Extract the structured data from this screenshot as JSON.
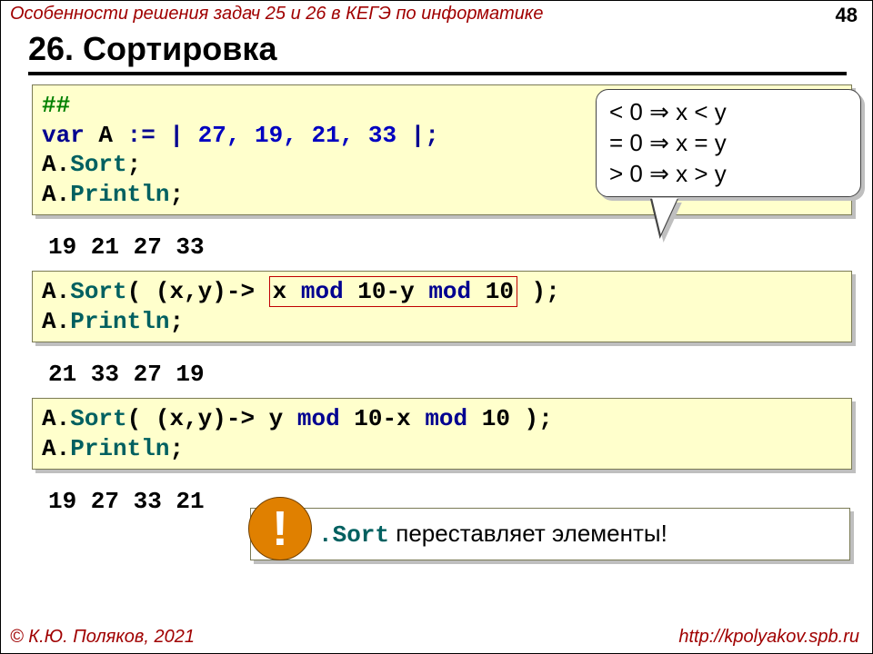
{
  "meta": {
    "subtitle": "Особенности решения задач 25 и 26 в КЕГЭ по информатике",
    "page": "48",
    "heading": "26. Сортировка"
  },
  "code": {
    "block1": {
      "l1": "##",
      "l2_var": "var",
      "l2_a": " A ",
      "l2_assign": ":= | ",
      "l2_nums": "27, 19, 21, 33",
      "l2_end": " |;",
      "l3_pre": "A.",
      "l3_sort": "Sort",
      "l3_end": ";",
      "l4_pre": "A.",
      "l4_pln": "Println",
      "l4_end": ";"
    },
    "out1": "19 21 27 33",
    "block2": {
      "l1_pre": "A.",
      "l1_sort": "Sort",
      "l1_open": "( (x,y)-> ",
      "l1_ins_a": "x ",
      "l1_ins_mod1": "mod",
      "l1_ins_b": " 10-y ",
      "l1_ins_mod2": "mod",
      "l1_ins_c": " 10",
      "l1_close": " );",
      "l2_pre": "A.",
      "l2_pln": "Println",
      "l2_end": ";"
    },
    "out2": "21 33 27 19",
    "block3": {
      "l1_pre": "A.",
      "l1_sort": "Sort",
      "l1_open": "( (x,y)-> y ",
      "l1_mod1": "mod",
      "l1_mid": " 10-x ",
      "l1_mod2": "mod",
      "l1_close2": " 10 );",
      "l2_pre": "A.",
      "l2_pln": "Println",
      "l2_end": ";"
    },
    "out3": "19 27 33 21"
  },
  "callout": {
    "r1_a": "< 0 ",
    "r1_arr": "⇒",
    "r1_b": " x < y",
    "r2_a": "= 0 ",
    "r2_arr": "⇒",
    "r2_b": " x = y",
    "r3_a": "> 0 ",
    "r3_arr": "⇒",
    "r3_b": " x > y"
  },
  "note": {
    "bang": "!",
    "sort": ".Sort",
    "rest": " переставляет элементы!"
  },
  "footer": {
    "left": "© К.Ю. Поляков, 2021",
    "right": "http://kpolyakov.spb.ru"
  }
}
